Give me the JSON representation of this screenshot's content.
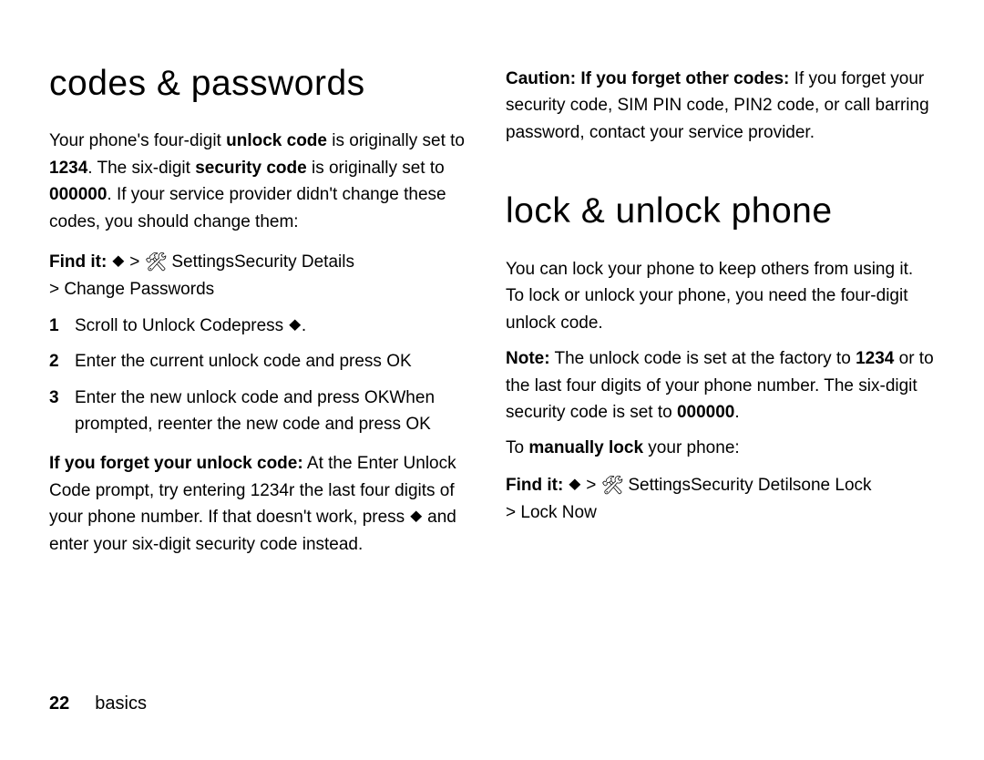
{
  "col1": {
    "h1": "codes & passwords",
    "intro_p1a": "Your phone's four-digit ",
    "intro_b1": "unlock code",
    "intro_p1b": " is originally set to ",
    "intro_b2": "1234",
    "intro_p1c": ". The six-digit ",
    "intro_b3": "security code",
    "intro_p1d": " is originally set to ",
    "intro_b4": "000000",
    "intro_p1e": ". If your service provider didn't change these codes, you should change them:",
    "findit_label": "Find it: ",
    "findit_path1": " Settings",
    "findit_path1b": "Security Details",
    "findit_path2": "> Change Passwords",
    "step1a": "Scroll to ",
    "step1b": "Unlock Code",
    "step1c": "press ",
    "step1d": ".",
    "step2a": "Enter the current unlock code and press ",
    "step2b": "OK",
    "step3a": "Enter the new unlock code and press ",
    "step3b": "OK",
    "step3c": "When prompted, reenter the new code and press ",
    "step3d": "OK",
    "forgot_b": "If you forget your unlock code:",
    "forgot_a": " At the ",
    "forgot_prompt": "Enter Unlock Code",
    "forgot_b2a": " prompt, try entering ",
    "forgot_1234": "1234",
    "forgot_b2b": "r the last four digits of your phone number. If that doesn't work, press ",
    "forgot_tail": " and enter your six-digit security code instead."
  },
  "col2": {
    "caution_b": "Caution: If you forget other codes:",
    "caution_t": " If you forget your security code, SIM PIN code, PIN2 code, or call barring password, contact your service provider.",
    "h1": "lock & unlock phone",
    "p1": "You can lock your phone to keep others from using it. To lock or unlock your phone, you need the four-digit unlock code.",
    "note_b": "Note:",
    "note_a": " The unlock code is set at the factory to ",
    "note_1234": "1234",
    "note_b2": " or to the last four digits of your phone number. The six-digit security code is set to ",
    "note_000000": "000000",
    "note_dot": ".",
    "manual_a": "To ",
    "manual_b": "manually lock",
    "manual_c": " your phone:",
    "findit_label": "Find it: ",
    "findit_path1": " Settings",
    "findit_path1b": "Security Det",
    "findit_path1c": "ils",
    "findit_path1d": "one Lock",
    "findit_path2": "> Lock Now"
  },
  "footer": {
    "page": "22",
    "section": "basics"
  },
  "glyphs": {
    "nav": "◈",
    "gt": " > ",
    "tools": "⚙"
  }
}
